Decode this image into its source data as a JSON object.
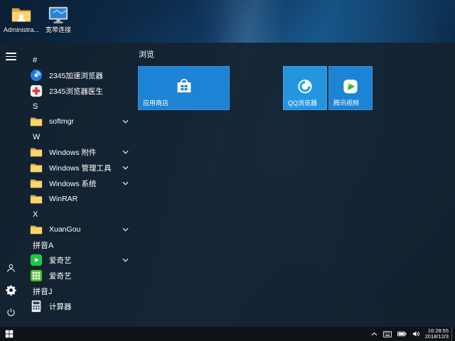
{
  "colors": {
    "tile_blue": "#1d83d4",
    "tile_blue_light": "#2496e0",
    "taskbar_bg": "#0f1318",
    "wallpaper_blue": "#0e3054",
    "folder_yellow": "#ffd36b"
  },
  "desktop": {
    "icons": [
      {
        "label": "Administra...",
        "icon": "user-folder-icon"
      },
      {
        "label": "宽带连接",
        "icon": "broadband-connection-icon"
      }
    ]
  },
  "start_menu": {
    "app_sections": [
      {
        "letter": "#",
        "items": [
          {
            "label": "2345加速浏览器",
            "icon": "2345-speed-browser-icon",
            "expandable": false
          },
          {
            "label": "2345浏览器医生",
            "icon": "2345-browser-doctor-icon",
            "expandable": false
          }
        ]
      },
      {
        "letter": "S",
        "items": [
          {
            "label": "softmgr",
            "icon": "folder-icon",
            "expandable": true
          }
        ]
      },
      {
        "letter": "W",
        "items": [
          {
            "label": "Windows 附件",
            "icon": "folder-icon",
            "expandable": true
          },
          {
            "label": "Windows 管理工具",
            "icon": "folder-icon",
            "expandable": true
          },
          {
            "label": "Windows 系统",
            "icon": "folder-icon",
            "expandable": true
          },
          {
            "label": "WinRAR",
            "icon": "folder-icon",
            "expandable": false
          }
        ]
      },
      {
        "letter": "X",
        "items": [
          {
            "label": "XuanGou",
            "icon": "folder-icon",
            "expandable": true
          }
        ]
      },
      {
        "letter": "拼音A",
        "items": [
          {
            "label": "爱奇艺",
            "icon": "iqiyi-play-icon",
            "expandable": true
          },
          {
            "label": "爱奇艺",
            "icon": "iqiyi-grid-icon",
            "expandable": false
          }
        ]
      },
      {
        "letter": "拼音J",
        "items": [
          {
            "label": "计算器",
            "icon": "calculator-icon",
            "expandable": false
          }
        ]
      }
    ],
    "tile_group": {
      "title": "浏览",
      "tiles": [
        {
          "label": "应用商店",
          "icon": "store-icon",
          "size": "wide"
        },
        {
          "label": "QQ浏览器",
          "icon": "qq-browser-icon",
          "size": "medium"
        },
        {
          "label": "腾讯视频",
          "icon": "tencent-video-icon",
          "size": "medium"
        }
      ]
    }
  },
  "taskbar": {
    "clock": {
      "time": "16:28:55",
      "date": "2018/12/3"
    }
  }
}
